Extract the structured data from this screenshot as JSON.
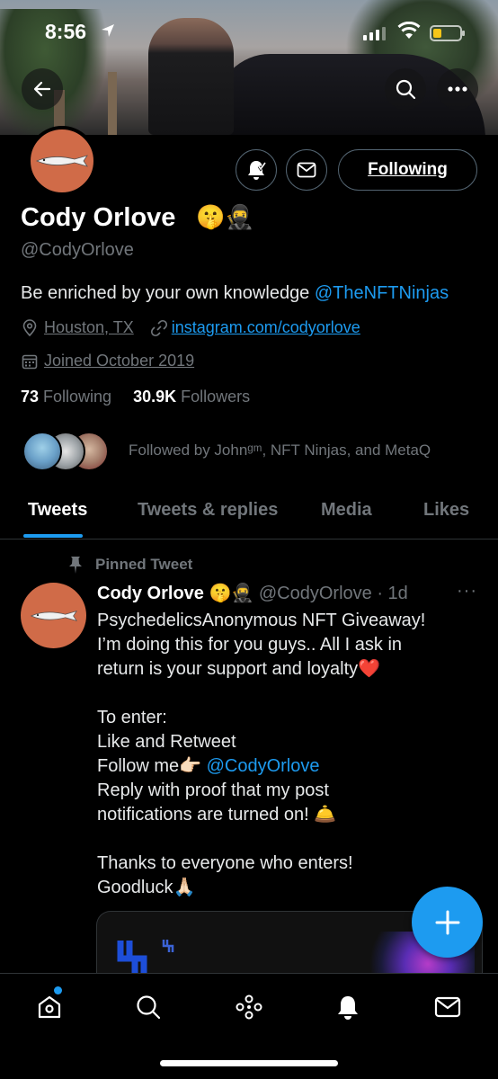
{
  "status_bar": {
    "time": "8:56"
  },
  "profile": {
    "name": "Cody Orlove",
    "name_emoji": "🤫🥷",
    "handle": "@CodyOrlove",
    "bio_text": "Be enriched by your own knowledge ",
    "bio_mention": "@TheNFTNinjas",
    "location": "Houston, TX",
    "website": "instagram.com/codyorlove",
    "joined": "Joined October 2019",
    "following_count": "73",
    "following_label": " Following",
    "followers_count": "30.9K",
    "followers_label": " Followers",
    "followed_by": "Followed by Johnᵍᵐ, NFT Ninjas, and MetaQ",
    "following_button": "Following"
  },
  "tabs": [
    {
      "label": "Tweets"
    },
    {
      "label": "Tweets & replies"
    },
    {
      "label": "Media"
    },
    {
      "label": "Likes"
    }
  ],
  "tweet": {
    "pinned_label": "Pinned Tweet",
    "author": "Cody Orlove",
    "author_emoji": "🤫🥷",
    "handle_time": "@CodyOrlove · 1d",
    "more": "···",
    "lines": {
      "l1": "PsychedelicsAnonymous NFT Giveaway!",
      "l2": "I’m doing this for you guys.. All I ask in",
      "l3": "return is your support and loyalty❤️",
      "l4": "To enter:",
      "l5": "Like and Retweet",
      "l6": "Follow me👉🏻 ",
      "l6_mention": "@CodyOrlove",
      "l7": "Reply with proof that my post",
      "l8": "notifications are turned on! 🛎️",
      "l9": "Thanks to everyone who enters!",
      "l10": "Goodluck🙏🏻"
    }
  },
  "colors": {
    "accent": "#1d9bf0",
    "secondary_text": "#71767b",
    "avatar_bg": "#d06b48"
  },
  "icons": [
    "back-arrow-icon",
    "search-icon",
    "more-icon",
    "notification-bell-icon",
    "mail-icon",
    "location-icon",
    "link-icon",
    "calendar-icon",
    "pin-icon",
    "compose-plus-icon",
    "home-icon",
    "explore-search-icon",
    "spaces-icon",
    "notifications-icon",
    "messages-icon"
  ]
}
